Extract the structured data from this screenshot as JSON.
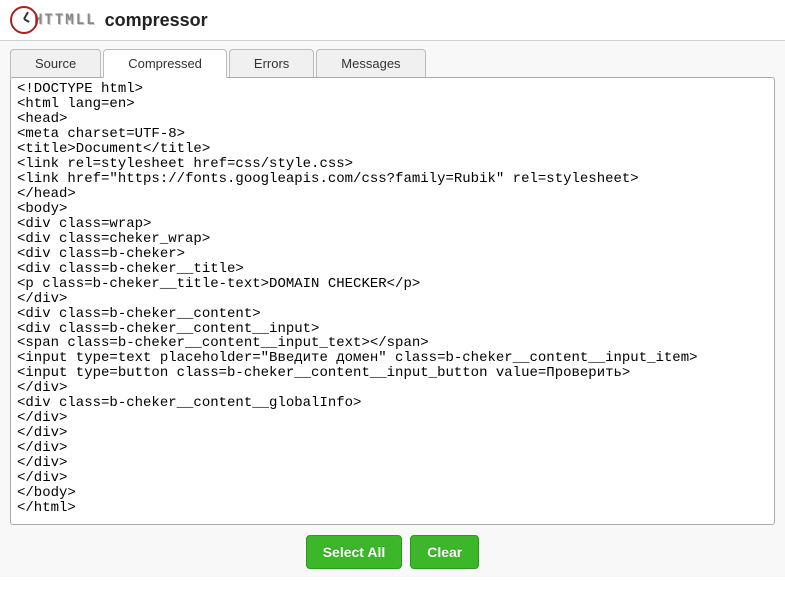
{
  "header": {
    "logo_html_text": "HTTMLL",
    "logo_compressor_text": "compressor"
  },
  "tabs": {
    "source": "Source",
    "compressed": "Compressed",
    "errors": "Errors",
    "messages": "Messages",
    "active": "compressed"
  },
  "code_content": "<!DOCTYPE html>\n<html lang=en>\n<head>\n<meta charset=UTF-8>\n<title>Document</title>\n<link rel=stylesheet href=css/style.css>\n<link href=\"https://fonts.googleapis.com/css?family=Rubik\" rel=stylesheet>\n</head>\n<body>\n<div class=wrap>\n<div class=cheker_wrap>\n<div class=b-cheker>\n<div class=b-cheker__title>\n<p class=b-cheker__title-text>DOMAIN CHECKER</p>\n</div>\n<div class=b-cheker__content>\n<div class=b-cheker__content__input>\n<span class=b-cheker__content__input_text></span>\n<input type=text placeholder=\"Введите домен\" class=b-cheker__content__input_item>\n<input type=button class=b-cheker__content__input_button value=Проверить>\n</div>\n<div class=b-cheker__content__globalInfo>\n</div>\n</div>\n</div>\n</div>\n</div>\n</body>\n</html>",
  "buttons": {
    "select_all": "Select All",
    "clear": "Clear"
  }
}
